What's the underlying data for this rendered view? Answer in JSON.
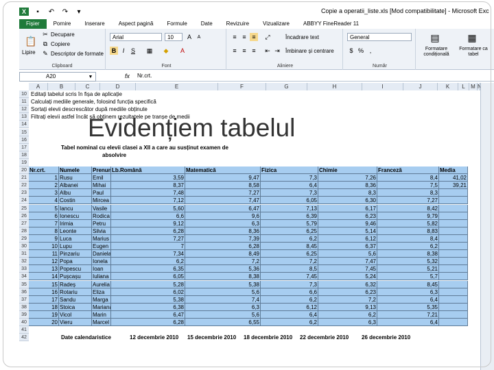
{
  "window": {
    "title": "Copie a operatii_liste.xls [Mod compatibilitate] - Microsoft Exc"
  },
  "tabs": [
    "Fișier",
    "Pornire",
    "Inserare",
    "Aspect pagină",
    "Formule",
    "Date",
    "Revizuire",
    "Vizualizare",
    "ABBYY FineReader 11"
  ],
  "clipboard": {
    "cut": "Decupare",
    "copy": "Copiere",
    "painter": "Descriptor de formate",
    "paste": "Lipire",
    "label": "Clipboard"
  },
  "font": {
    "name": "Arial",
    "size": "10",
    "label": "Font"
  },
  "alignment": {
    "wrap": "Încadrare text",
    "merge": "Îmbinare și centrare",
    "label": "Aliniere"
  },
  "number": {
    "format": "General",
    "label": "Număr"
  },
  "styles": {
    "conditional": "Formatare condițională",
    "table": "Formatare ca tabel"
  },
  "formula_bar": {
    "name_box": "A20",
    "fx": "fx",
    "value": "Nr.crt."
  },
  "columns": [
    "A",
    "B",
    "C",
    "D",
    "E",
    "F",
    "G",
    "H",
    "I",
    "J",
    "K",
    "L",
    "M",
    "N"
  ],
  "instructions": [
    {
      "row": "10",
      "text": "Editați tabelul scris în fișa de aplicație"
    },
    {
      "row": "11",
      "text": "Calculați mediile generale, folosind funcția specifică"
    },
    {
      "row": "12",
      "text": "Sortați elevii descrescător după mediile obținute"
    },
    {
      "row": "13",
      "text": "Filtrați elevii astfel încât să obținem rezultatele pe tranșe de medii"
    }
  ],
  "overlay_title": "Evidențiem tabelul",
  "table_title_line1": "Tabel nominal cu elevii clasei a XII a care au susținut examen de",
  "table_title_line2": "absolvire",
  "headers": [
    "Nr.crt.",
    "Numele",
    "Prenum",
    "Lb.Română",
    "Matematică",
    "Fizica",
    "Chimie",
    "Franceză",
    "Media"
  ],
  "students": [
    [
      "1",
      "Rusu",
      "Emil",
      "3,59",
      "9,47",
      "7,3",
      "7,26",
      "8,4",
      "41,02"
    ],
    [
      "2",
      "Albanei",
      "Mihai",
      "8,37",
      "8,58",
      "6,4",
      "8,36",
      "7,5",
      "39,21"
    ],
    [
      "3",
      "Albu",
      "Paul",
      "7,48",
      "7,27",
      "7,3",
      "8,3",
      "8,3",
      ""
    ],
    [
      "4",
      "Costin",
      "Mircea",
      "7,12",
      "7,47",
      "6,05",
      "6,30",
      "7,27",
      ""
    ],
    [
      "5",
      "Iancu",
      "Vasile",
      "5,60",
      "6,47",
      "7,13",
      "6,17",
      "8,42",
      ""
    ],
    [
      "6",
      "Ionescu",
      "Rodica",
      "6,6",
      "9,6",
      "6,39",
      "6,23",
      "9,79",
      ""
    ],
    [
      "7",
      "Irimia",
      "Petru",
      "9,12",
      "6,3",
      "5,79",
      "9,46",
      "5,82",
      ""
    ],
    [
      "8",
      "Leonte",
      "Silvia",
      "6,28",
      "8,36",
      "6,25",
      "5,14",
      "8,83",
      ""
    ],
    [
      "9",
      "Luca",
      "Marius",
      "7,27",
      "7,39",
      "6,2",
      "6,12",
      "8,4",
      ""
    ],
    [
      "10",
      "Lupu",
      "Eugen",
      "7",
      "6,28",
      "8,45",
      "6,37",
      "6,2",
      ""
    ],
    [
      "11",
      "Pinzariu",
      "Daniela",
      "7,34",
      "8,49",
      "6,25",
      "5,6",
      "8,38",
      ""
    ],
    [
      "12",
      "Popa",
      "Ionela",
      "6,2",
      "7,2",
      "7,2",
      "7,47",
      "5,32",
      ""
    ],
    [
      "13",
      "Popescu",
      "Ioan",
      "6,35",
      "5,36",
      "8,5",
      "7,45",
      "5,21",
      ""
    ],
    [
      "14",
      "Pușcașu",
      "Iuliana",
      "6,05",
      "8,38",
      "7,45",
      "5,24",
      "5,7",
      ""
    ],
    [
      "15",
      "Radeș",
      "Aurelia",
      "5,28",
      "5,38",
      "7,3",
      "6,32",
      "8,45",
      ""
    ],
    [
      "16",
      "Rotariu",
      "Eliza",
      "6,02",
      "5,6",
      "6,6",
      "6,23",
      "6,3",
      ""
    ],
    [
      "17",
      "Sandu",
      "Marga",
      "5,38",
      "7,4",
      "6,2",
      "7,2",
      "6,4",
      ""
    ],
    [
      "18",
      "Stoica",
      "Mariana",
      "6,38",
      "6,3",
      "6,12",
      "9,13",
      "5,35",
      ""
    ],
    [
      "19",
      "Vicol",
      "Marin",
      "6,47",
      "5,6",
      "6,4",
      "6,2",
      "7,21",
      ""
    ],
    [
      "20",
      "Vieru",
      "Marcel",
      "6,28",
      "6,55",
      "6,2",
      "6,3",
      "6,4",
      ""
    ]
  ],
  "dates": {
    "label": "Date calendaristice",
    "values": [
      "12 decembrie 2010",
      "15 decembrie 2010",
      "18 decembrie 2010",
      "22 decembrie 2010",
      "26 decembrie 2010"
    ]
  },
  "rows": {
    "first": 10,
    "last": 42
  },
  "colors": {
    "highlight": "#a7cdf0",
    "file_tab": "#1f7a3a"
  }
}
